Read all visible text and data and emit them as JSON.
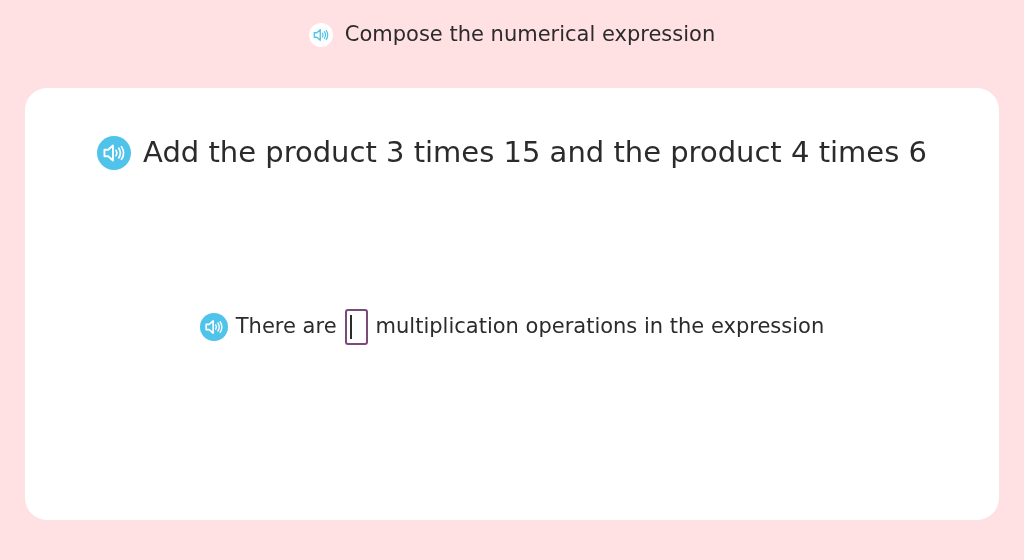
{
  "header": {
    "title": "Compose the numerical expression"
  },
  "question": {
    "text": "Add the product 3 times 15 and the product 4 times 6"
  },
  "sentence": {
    "before": "There are",
    "answer_field": {
      "focused": true
    },
    "after": "multiplication operations in the expression"
  }
}
